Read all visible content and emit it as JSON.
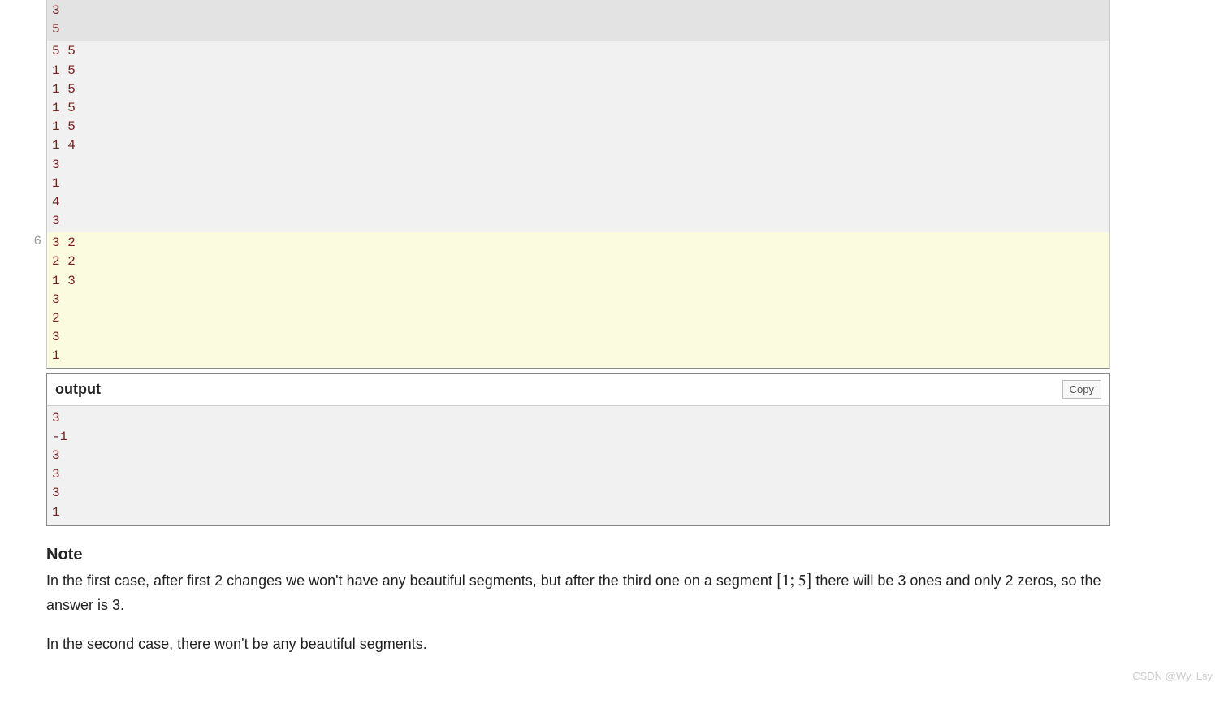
{
  "input": {
    "block_top_lines": [
      "3",
      "5"
    ],
    "block_mid_lines": [
      "5 5",
      "1 5",
      "1 5",
      "1 5",
      "1 5",
      "1 4",
      "3",
      "1",
      "4",
      "3"
    ],
    "block_highlight_lines": [
      "3 2",
      "2 2",
      "1 3",
      "3",
      "2",
      "3",
      "1"
    ],
    "line_number_label": "6"
  },
  "output": {
    "header_label": "output",
    "copy_label": "Copy",
    "lines": [
      "3",
      "-1",
      "3",
      "3",
      "3",
      "1"
    ]
  },
  "note": {
    "title": "Note",
    "para1_prefix": "In the first case, after first 2 changes we won't have any beautiful segments, but after the third one on a segment ",
    "para1_math": "[1; 5]",
    "para1_suffix": " there will be 3 ones and only 2 zeros, so the answer is 3.",
    "para2": "In the second case, there won't be any beautiful segments."
  },
  "watermark": "CSDN @Wy. Lsy"
}
